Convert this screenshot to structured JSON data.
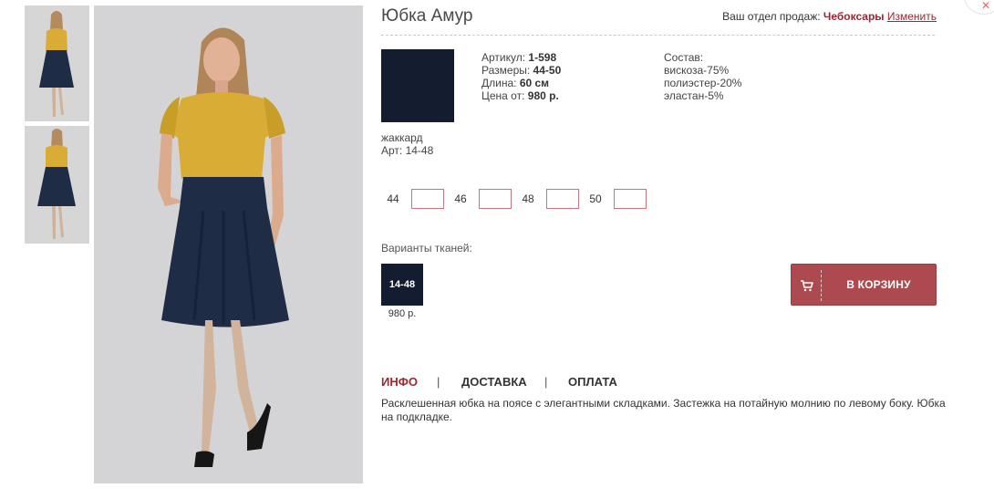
{
  "product": {
    "title": "Юбка Амур"
  },
  "region": {
    "label": "Ваш отдел продаж:",
    "city": "Чебоксары",
    "change": "Изменить"
  },
  "fabric": {
    "name": "жаккард",
    "code": "Арт: 14-48"
  },
  "specs": {
    "article_label": "Артикул:",
    "article": "1-598",
    "sizes_label": "Размеры:",
    "sizes": "44-50",
    "length_label": "Длина:",
    "length": "60 см",
    "price_label": "Цена от:",
    "price": "980 р."
  },
  "composition": {
    "label": "Состав:",
    "items": [
      "вискоза-75%",
      "полиэстер-20%",
      "эластан-5%"
    ]
  },
  "size_options": [
    {
      "label": "44",
      "value": ""
    },
    {
      "label": "46",
      "value": ""
    },
    {
      "label": "48",
      "value": ""
    },
    {
      "label": "50",
      "value": ""
    }
  ],
  "variants": {
    "title": "Варианты тканей:",
    "items": [
      {
        "code": "14-48",
        "price": "980 р.",
        "color": "#131d2f"
      }
    ]
  },
  "cart": {
    "label": "В КОРЗИНУ",
    "icon": "cart-icon"
  },
  "tabs": [
    {
      "label": "ИНФО",
      "active": true
    },
    {
      "label": "ДОСТАВКА",
      "active": false
    },
    {
      "label": "ОПЛАТА",
      "active": false
    }
  ],
  "tab_separator": "|",
  "description": "Расклешенная юбка на поясе с элегантными складками. Застежка на потайную молнию по левому боку. Юбка на подкладке.",
  "colors": {
    "accent": "#9b2730",
    "button": "#ac4a4f",
    "swatch": "#131d2f",
    "input_border": "#c9747c"
  }
}
